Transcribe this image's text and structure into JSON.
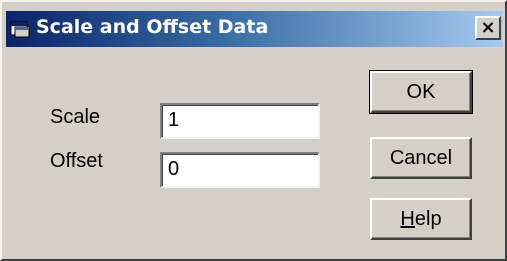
{
  "window": {
    "title": "Scale and Offset Data",
    "close_label": "×"
  },
  "form": {
    "scale_label": "Scale",
    "scale_value": "1",
    "offset_label": "Offset",
    "offset_value": "0"
  },
  "buttons": {
    "ok_label": "OK",
    "cancel_label": "Cancel",
    "help_accel": "H",
    "help_rest": "elp"
  },
  "icons": {
    "title_icon": "dialog-window-icon",
    "close_icon": "close-icon"
  }
}
